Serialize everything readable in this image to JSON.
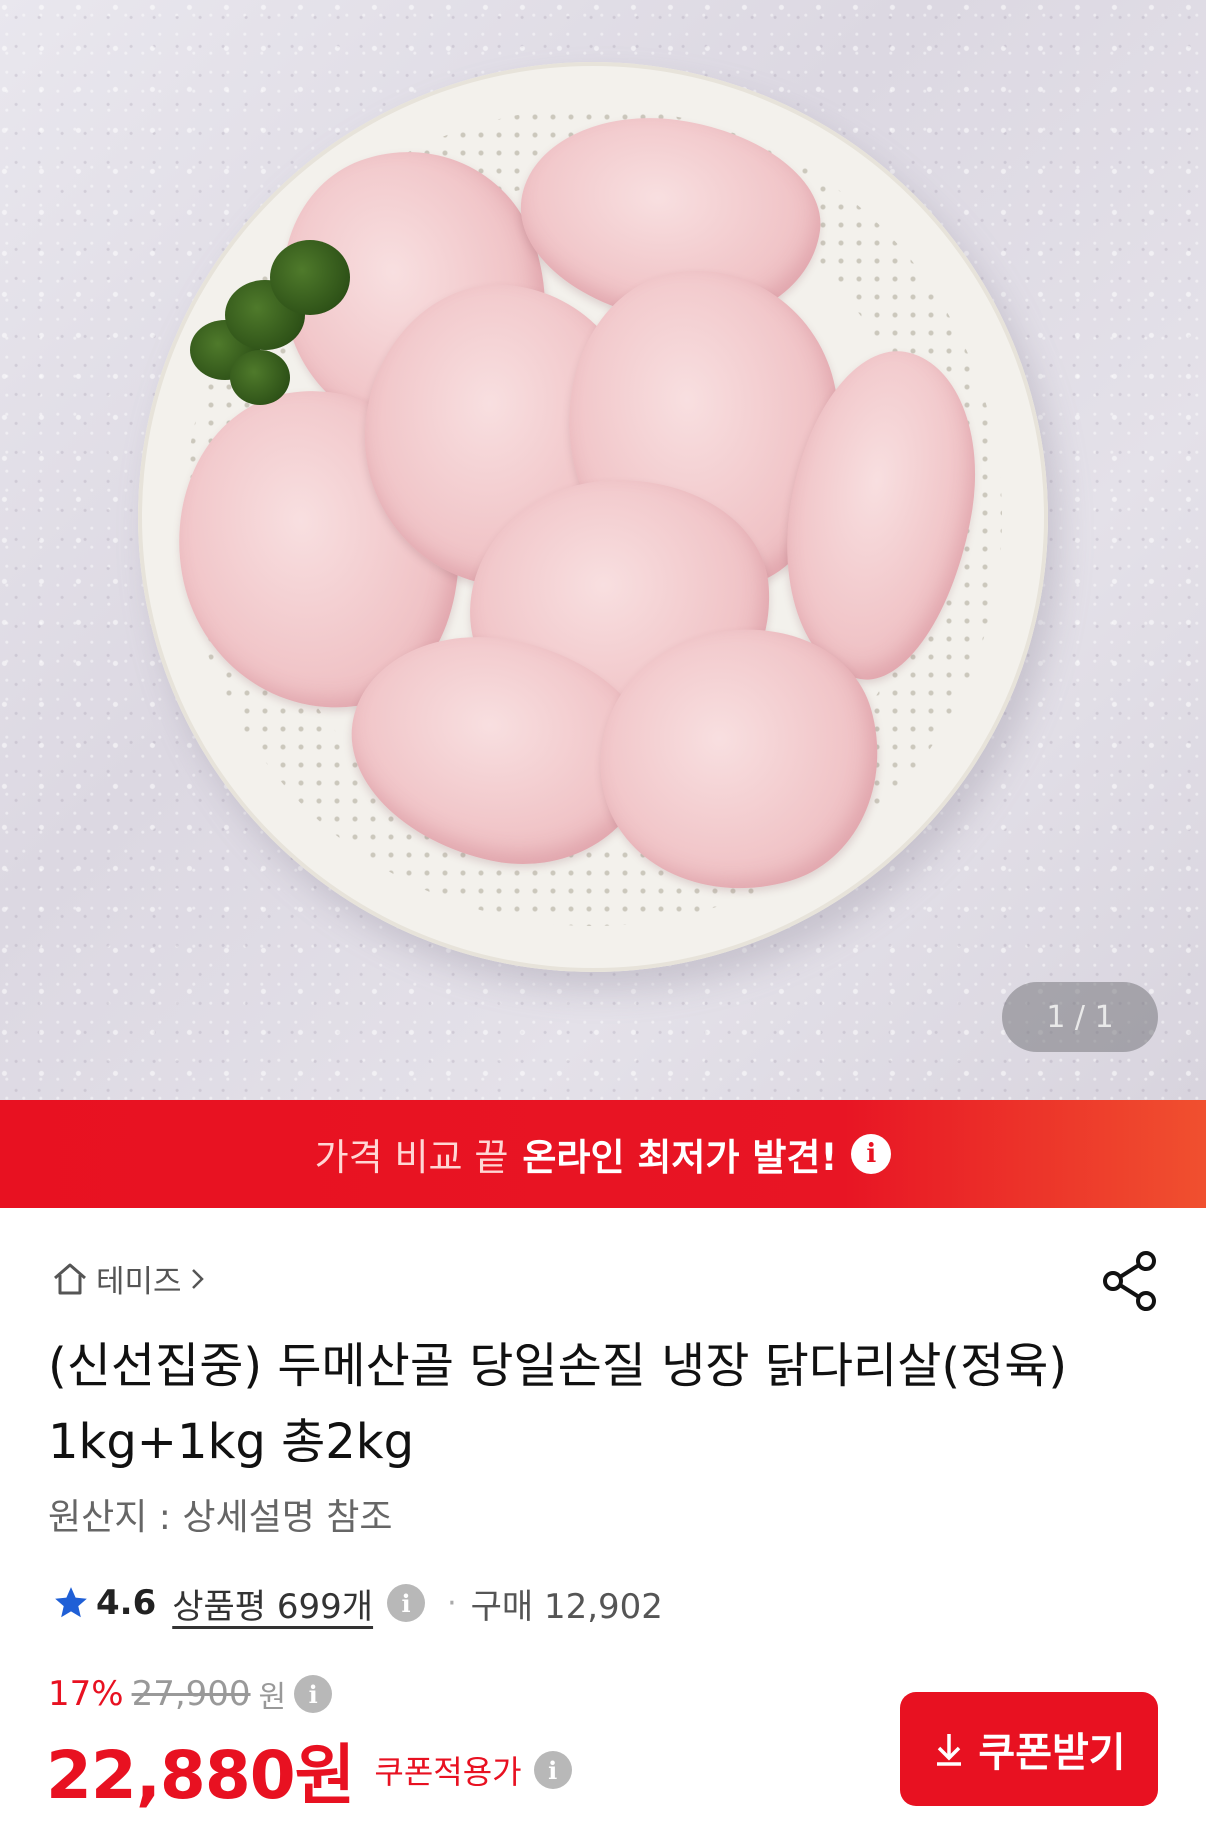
{
  "gallery": {
    "image_alt": "",
    "page_indicator": "1 / 1"
  },
  "banner": {
    "prefix": "가격 비교 끝",
    "highlight": "온라인 최저가 발견!"
  },
  "store": {
    "name": "테미즈"
  },
  "product": {
    "title": "(신선집중) 두메산골 당일손질 냉장 닭다리살(정육) 1kg+1kg 총2kg",
    "origin": "원산지 : 상세설명 참조"
  },
  "rating": {
    "score": "4.6",
    "reviews": "상품평 699개",
    "purchases": "구매 12,902"
  },
  "pricing": {
    "discount_rate": "17%",
    "original_price": "27,900",
    "original_unit": "원",
    "sale_price": "22,880원",
    "sale_label": "쿠폰적용가",
    "coupon_button": "쿠폰받기"
  },
  "colors": {
    "accent_red": "#e81121",
    "star_blue": "#1f5fd6"
  },
  "icons": [
    "home-icon",
    "chevron-right-icon",
    "share-icon",
    "info-icon",
    "star-icon",
    "download-icon"
  ]
}
